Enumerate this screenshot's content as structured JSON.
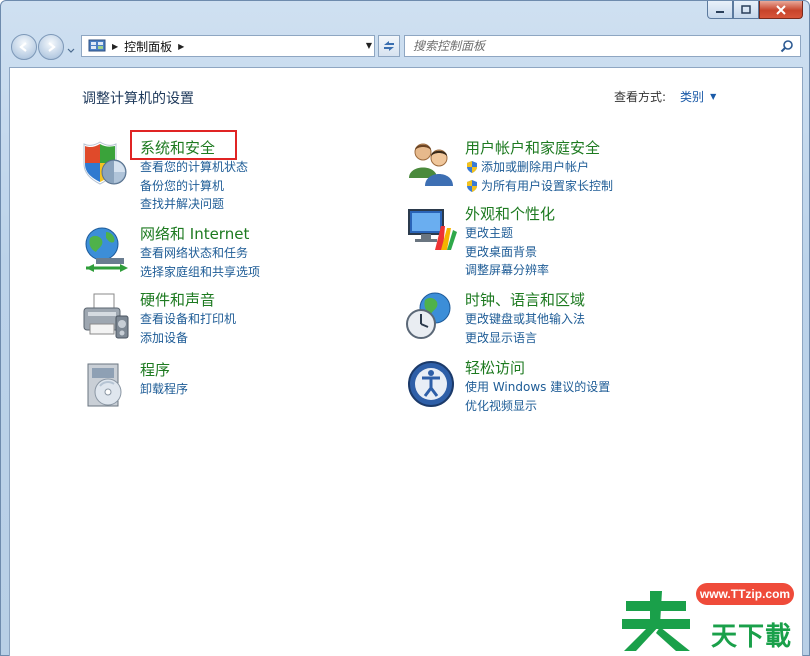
{
  "window": {
    "caption_buttons": [
      "minimize-icon",
      "maximize-icon",
      "close-icon"
    ]
  },
  "nav": {
    "breadcrumb": "控制面板",
    "search_placeholder": "搜索控制面板"
  },
  "main": {
    "title": "调整计算机的设置",
    "view_by_label": "查看方式:",
    "view_by_value": "类别"
  },
  "categories": {
    "system_security": {
      "title": "系统和安全",
      "links": [
        "查看您的计算机状态",
        "备份您的计算机",
        "查找并解决问题"
      ],
      "icon": "shield-icon"
    },
    "network": {
      "title": "网络和 Internet",
      "links": [
        "查看网络状态和任务",
        "选择家庭组和共享选项"
      ],
      "icon": "globe-network-icon"
    },
    "hardware": {
      "title": "硬件和声音",
      "links": [
        "查看设备和打印机",
        "添加设备"
      ],
      "icon": "printer-icon"
    },
    "programs": {
      "title": "程序",
      "links": [
        "卸载程序"
      ],
      "icon": "programs-icon"
    },
    "user_accounts": {
      "title": "用户帐户和家庭安全",
      "links": [
        "添加或删除用户帐户",
        "为所有用户设置家长控制"
      ],
      "icon": "users-icon"
    },
    "appearance": {
      "title": "外观和个性化",
      "links": [
        "更改主题",
        "更改桌面背景",
        "调整屏幕分辨率"
      ],
      "icon": "monitor-paint-icon"
    },
    "clock_region": {
      "title": "时钟、语言和区域",
      "links": [
        "更改键盘或其他输入法",
        "更改显示语言"
      ],
      "icon": "clock-globe-icon"
    },
    "ease_access": {
      "title": "轻松访问",
      "links": [
        "使用 Windows 建议的设置",
        "优化视频显示"
      ],
      "icon": "ease-of-access-icon"
    }
  },
  "watermark": {
    "url": "www.TTzip.com",
    "text": "天下載"
  },
  "colors": {
    "category_title": "#1d7a20",
    "link": "#1e5c96",
    "highlight": "#e02424"
  }
}
